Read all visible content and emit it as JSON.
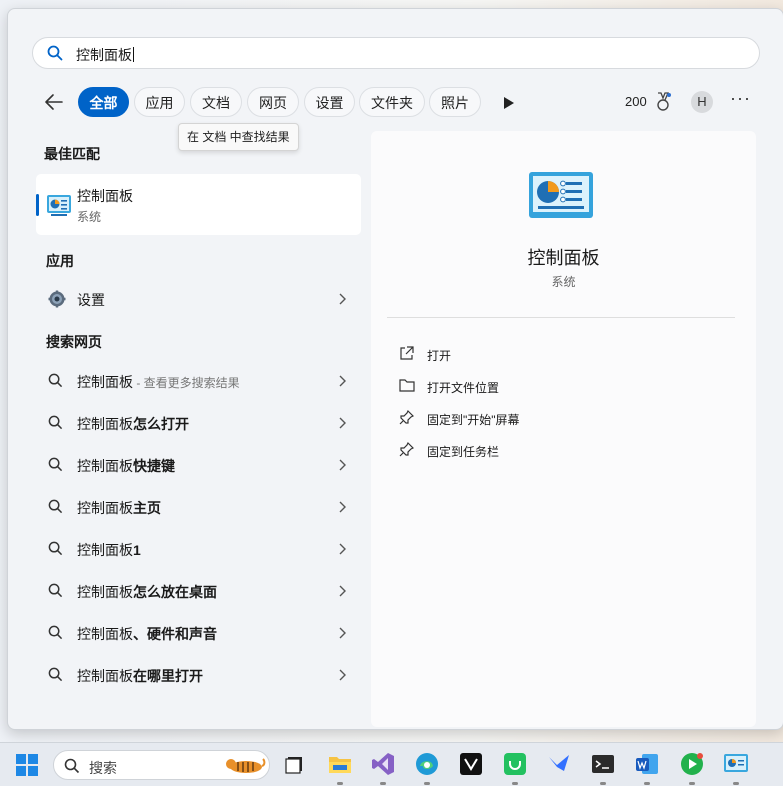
{
  "search": {
    "query": "控制面板"
  },
  "filters": {
    "chips": [
      {
        "label": "全部",
        "active": true
      },
      {
        "label": "应用",
        "active": false
      },
      {
        "label": "文档",
        "active": false
      },
      {
        "label": "网页",
        "active": false
      },
      {
        "label": "设置",
        "active": false
      },
      {
        "label": "文件夹",
        "active": false
      },
      {
        "label": "照片",
        "active": false
      }
    ],
    "points": "200",
    "avatar": "H"
  },
  "tooltip": "在 文档 中查找结果",
  "best_match": {
    "heading": "最佳匹配",
    "title": "控制面板",
    "subtitle": "系统"
  },
  "apps": {
    "heading": "应用",
    "items": [
      {
        "label": "设置"
      }
    ]
  },
  "web": {
    "heading": "搜索网页",
    "items": [
      {
        "base": "控制面板",
        "bold": "",
        "hint": " - 查看更多搜索结果"
      },
      {
        "base": "控制面板",
        "bold": "怎么打开",
        "hint": ""
      },
      {
        "base": "控制面板",
        "bold": "快捷键",
        "hint": ""
      },
      {
        "base": "控制面板",
        "bold": "主页",
        "hint": ""
      },
      {
        "base": "控制面板",
        "bold": "1",
        "hint": ""
      },
      {
        "base": "控制面板",
        "bold": "怎么放在桌面",
        "hint": ""
      },
      {
        "base": "控制面板",
        "bold": "、硬件和声音",
        "hint": ""
      },
      {
        "base": "控制面板",
        "bold": "在哪里打开",
        "hint": ""
      }
    ]
  },
  "detail": {
    "title": "控制面板",
    "subtitle": "系统",
    "actions": [
      {
        "label": "打开",
        "icon": "open-external-icon"
      },
      {
        "label": "打开文件位置",
        "icon": "folder-icon"
      },
      {
        "label": "固定到\"开始\"屏幕",
        "icon": "pin-icon"
      },
      {
        "label": "固定到任务栏",
        "icon": "pin-icon"
      }
    ]
  },
  "taskbar": {
    "search_placeholder": "搜索",
    "apps": [
      "task-view-icon",
      "file-explorer-icon",
      "visual-studio-icon",
      "edge-icon",
      "jetbrains-icon",
      "wechat-icon",
      "feishu-icon",
      "terminal-icon",
      "word-icon",
      "media-player-icon",
      "control-panel-icon"
    ]
  },
  "colors": {
    "accent": "#0063c8",
    "panel": "#f2f4f7"
  }
}
